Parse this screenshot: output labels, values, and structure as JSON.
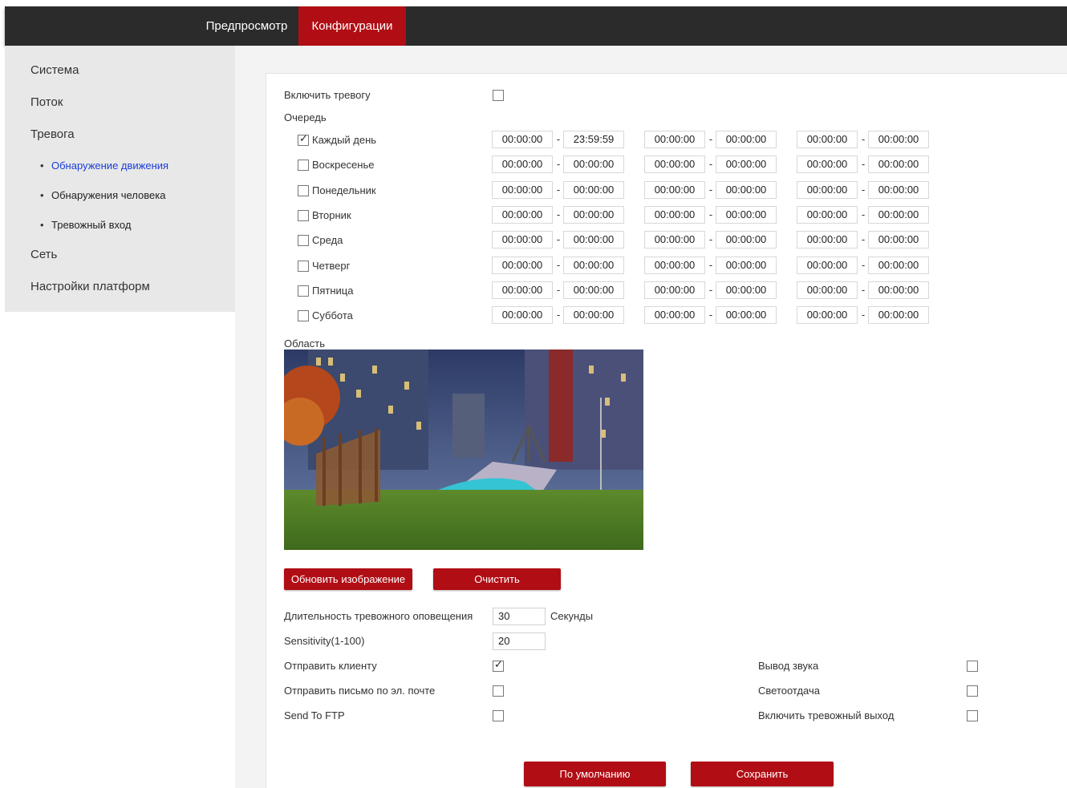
{
  "nav": {
    "tabs": [
      {
        "label": "Предпросмотр",
        "active": false
      },
      {
        "label": "Конфигурации",
        "active": true
      }
    ]
  },
  "sidebar": {
    "items": [
      "Система",
      "Поток",
      "Тревога"
    ],
    "subitems": [
      {
        "label": "Обнаружение движения",
        "active": true
      },
      {
        "label": "Обнаружения человека",
        "active": false
      },
      {
        "label": "Тревожный вход",
        "active": false
      }
    ],
    "items_after": [
      "Сеть",
      "Настройки платформ"
    ]
  },
  "form": {
    "enable_alarm_label": "Включить тревогу",
    "enable_alarm_checked": false,
    "schedule_label": "Очередь",
    "dash": "-",
    "days": [
      {
        "label": "Каждый день",
        "checked": true,
        "times": [
          "00:00:00",
          "23:59:59",
          "00:00:00",
          "00:00:00",
          "00:00:00",
          "00:00:00"
        ]
      },
      {
        "label": "Воскресенье",
        "checked": false,
        "times": [
          "00:00:00",
          "00:00:00",
          "00:00:00",
          "00:00:00",
          "00:00:00",
          "00:00:00"
        ]
      },
      {
        "label": "Понедельник",
        "checked": false,
        "times": [
          "00:00:00",
          "00:00:00",
          "00:00:00",
          "00:00:00",
          "00:00:00",
          "00:00:00"
        ]
      },
      {
        "label": "Вторник",
        "checked": false,
        "times": [
          "00:00:00",
          "00:00:00",
          "00:00:00",
          "00:00:00",
          "00:00:00",
          "00:00:00"
        ]
      },
      {
        "label": "Среда",
        "checked": false,
        "times": [
          "00:00:00",
          "00:00:00",
          "00:00:00",
          "00:00:00",
          "00:00:00",
          "00:00:00"
        ]
      },
      {
        "label": "Четверг",
        "checked": false,
        "times": [
          "00:00:00",
          "00:00:00",
          "00:00:00",
          "00:00:00",
          "00:00:00",
          "00:00:00"
        ]
      },
      {
        "label": "Пятница",
        "checked": false,
        "times": [
          "00:00:00",
          "00:00:00",
          "00:00:00",
          "00:00:00",
          "00:00:00",
          "00:00:00"
        ]
      },
      {
        "label": "Суббота",
        "checked": false,
        "times": [
          "00:00:00",
          "00:00:00",
          "00:00:00",
          "00:00:00",
          "00:00:00",
          "00:00:00"
        ]
      }
    ],
    "area_label": "Область",
    "refresh_button": "Обновить изображение",
    "clear_button": "Очистить",
    "duration_label": "Длительность тревожного оповещения",
    "duration_value": "30",
    "duration_unit": "Секунды",
    "sensitivity_label": "Sensitivity(1-100)",
    "sensitivity_value": "20",
    "send_client_label": "Отправить клиенту",
    "send_client_checked": true,
    "send_email_label": "Отправить письмо по эл. почте",
    "send_email_checked": false,
    "send_ftp_label": "Send To FTP",
    "send_ftp_checked": false,
    "sound_out_label": "Вывод звука",
    "sound_out_checked": false,
    "light_out_label": "Светоотдача",
    "light_out_checked": false,
    "alarm_out_label": "Включить тревожный выход",
    "alarm_out_checked": false,
    "default_button": "По умолчанию",
    "save_button": "Сохранить"
  },
  "colors": {
    "accent": "#b10d14",
    "topbar": "#2b2b2b",
    "sidebar": "#e8e8e8",
    "active_link": "#1a3ed8"
  }
}
